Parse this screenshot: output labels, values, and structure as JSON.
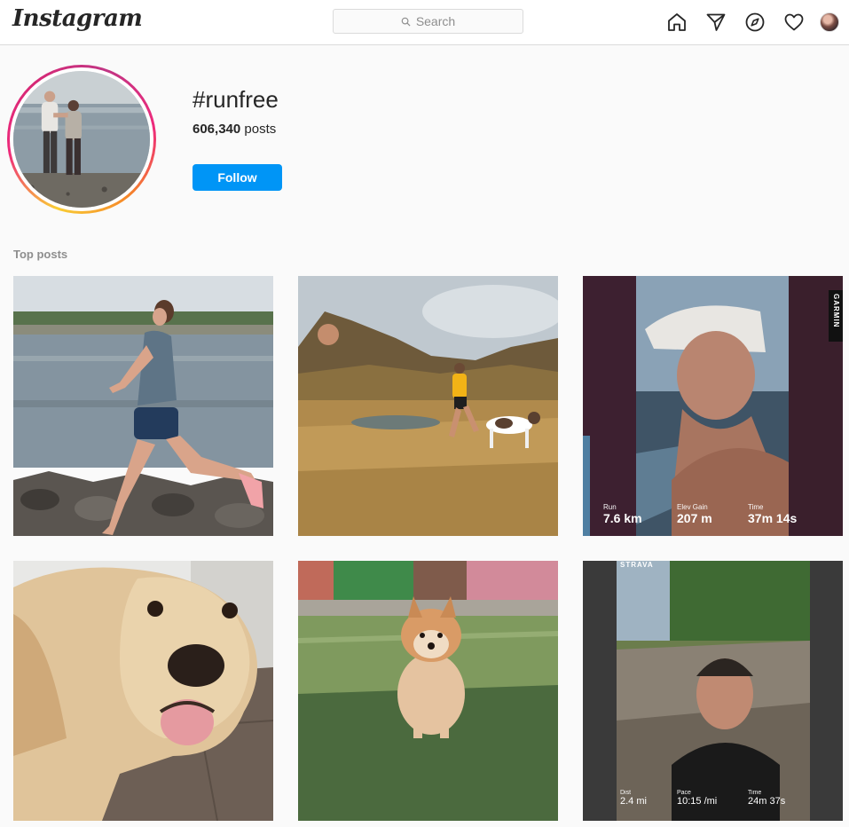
{
  "nav": {
    "logo": "Instagram",
    "search_placeholder": "Search",
    "icons": [
      "home-icon",
      "direct-icon",
      "explore-icon",
      "activity-heart-icon",
      "profile-avatar"
    ]
  },
  "header": {
    "hashtag": "#runfree",
    "post_count": "606,340",
    "posts_word": "posts",
    "follow_label": "Follow"
  },
  "section": {
    "top_posts_label": "Top posts"
  },
  "posts": [
    {
      "id": "post-1"
    },
    {
      "id": "post-2"
    },
    {
      "id": "post-3",
      "brand": "GARMIN",
      "stats": [
        {
          "label": "Run",
          "value": "7.6 km"
        },
        {
          "label": "Elev Gain",
          "value": "207 m"
        },
        {
          "label": "Time",
          "value": "37m 14s"
        }
      ]
    },
    {
      "id": "post-4"
    },
    {
      "id": "post-5"
    },
    {
      "id": "post-6",
      "brand": "STRAVA",
      "stats": [
        {
          "label": "Dist",
          "value": "2.4 mi"
        },
        {
          "label": "Pace",
          "value": "10:15 /mi"
        },
        {
          "label": "Time",
          "value": "24m 37s"
        }
      ]
    }
  ],
  "colors": {
    "follow_blue": "#0095f6",
    "background": "#fafafa",
    "border": "#dbdbdb",
    "muted_text": "#8e8e8e"
  }
}
